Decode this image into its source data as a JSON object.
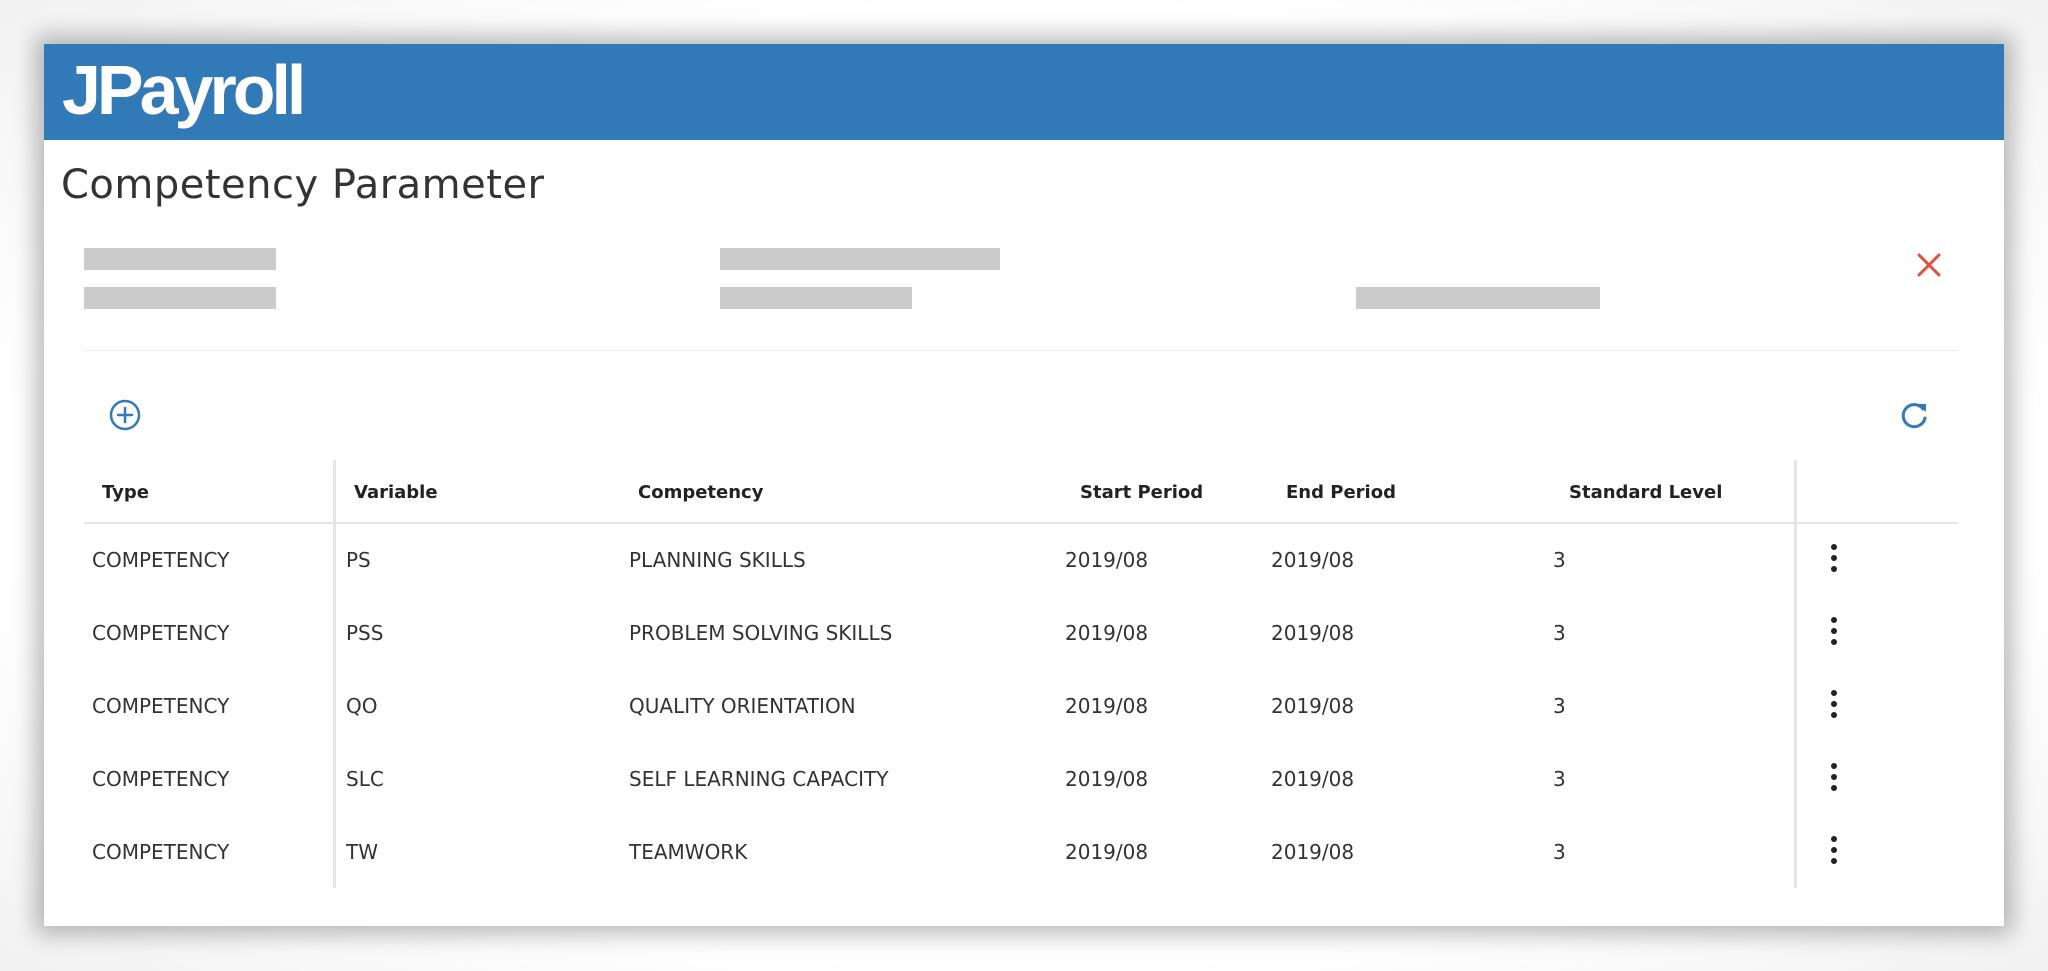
{
  "app": {
    "logo_text": "JPayroll",
    "header_color": "#3279b8"
  },
  "page": {
    "title": "Competency Parameter"
  },
  "icons": {
    "close": "close-icon",
    "add": "add-circle-icon",
    "refresh": "refresh-icon",
    "row_menu": "more-vertical-icon"
  },
  "table": {
    "headers": {
      "type": "Type",
      "variable": "Variable",
      "competency": "Competency",
      "start_period": "Start Period",
      "end_period": "End Period",
      "standard_level": "Standard Level"
    },
    "rows": [
      {
        "type": "COMPETENCY",
        "variable": "PS",
        "competency": "PLANNING SKILLS",
        "start_period": "2019/08",
        "end_period": "2019/08",
        "standard_level": "3"
      },
      {
        "type": "COMPETENCY",
        "variable": "PSS",
        "competency": "PROBLEM SOLVING SKILLS",
        "start_period": "2019/08",
        "end_period": "2019/08",
        "standard_level": "3"
      },
      {
        "type": "COMPETENCY",
        "variable": "QO",
        "competency": "QUALITY ORIENTATION",
        "start_period": "2019/08",
        "end_period": "2019/08",
        "standard_level": "3"
      },
      {
        "type": "COMPETENCY",
        "variable": "SLC",
        "competency": "SELF LEARNING CAPACITY",
        "start_period": "2019/08",
        "end_period": "2019/08",
        "standard_level": "3"
      },
      {
        "type": "COMPETENCY",
        "variable": "TW",
        "competency": "TEAMWORK",
        "start_period": "2019/08",
        "end_period": "2019/08",
        "standard_level": "3"
      }
    ]
  }
}
